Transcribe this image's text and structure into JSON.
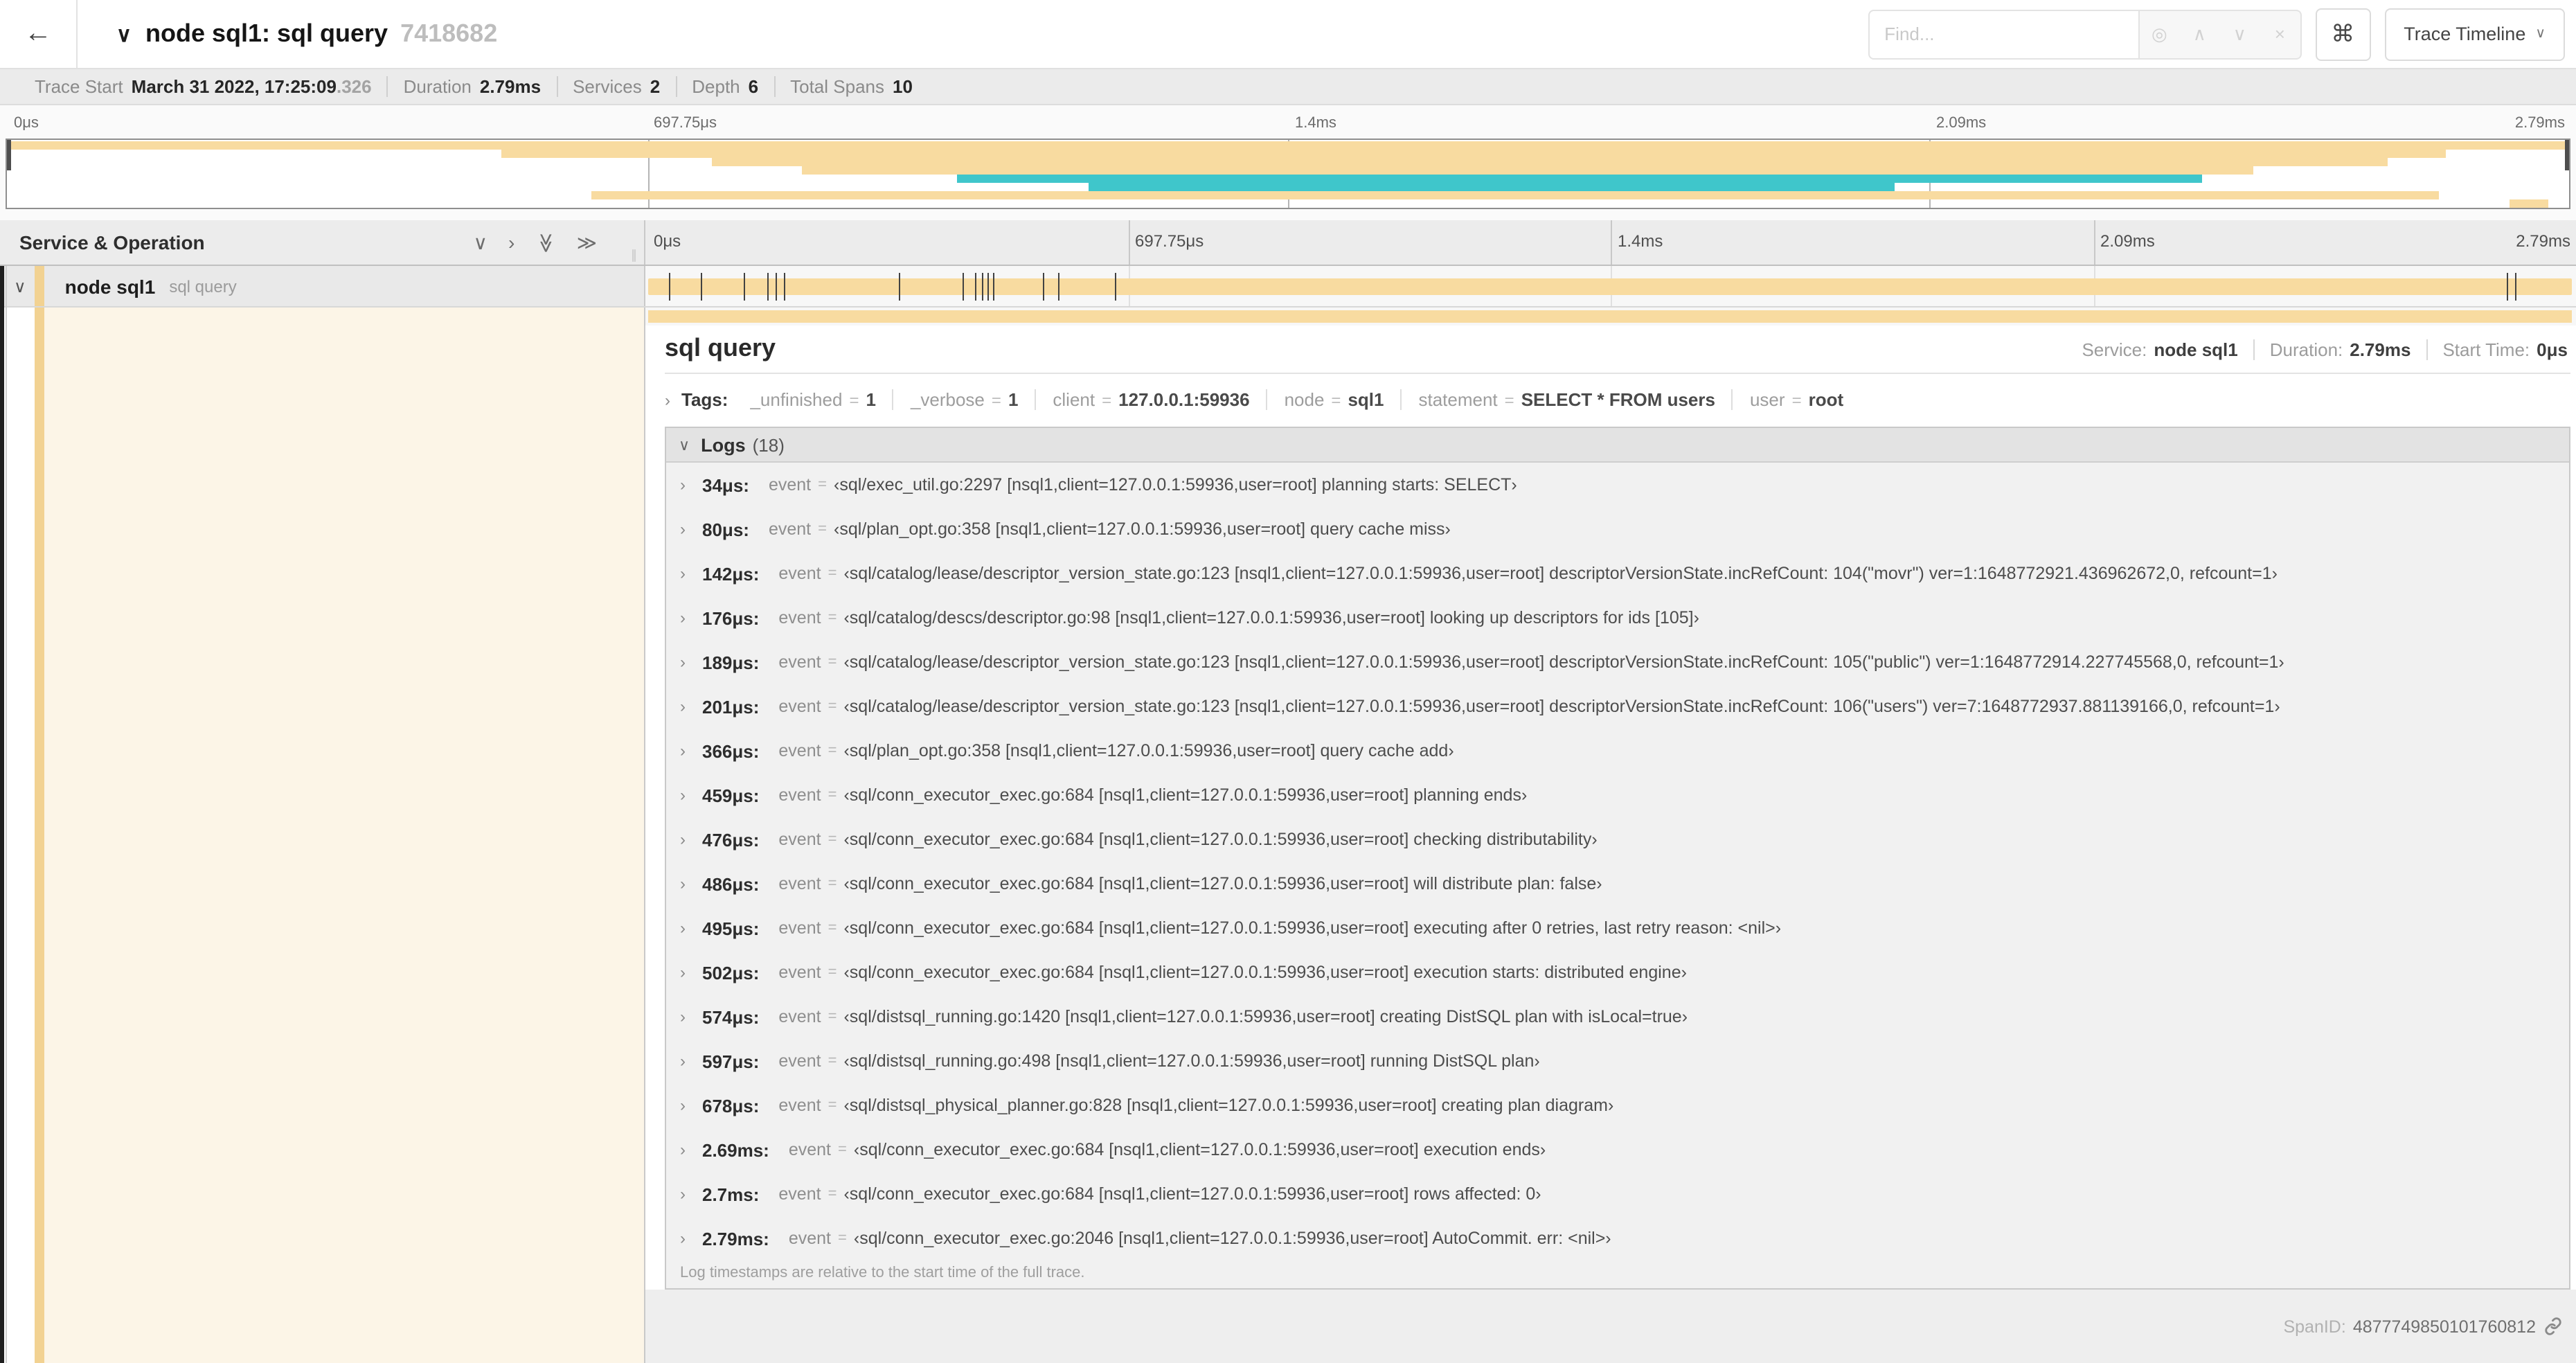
{
  "icons": {
    "back": "←",
    "chevron_down": "∨",
    "chevron_right": "›",
    "double_chevron": "≫",
    "find_target": "◎",
    "find_prev": "∧",
    "find_next": "∨",
    "find_clear": "×",
    "keyboard_cmd": "⌘",
    "resizer_grip": "∥"
  },
  "header": {
    "title": "node sql1: sql query",
    "trace_id_short": "7418682",
    "find_placeholder": "Find...",
    "view_selector_label": "Trace Timeline"
  },
  "trace_info": {
    "items": [
      {
        "label": "Trace Start",
        "value": "March 31 2022, 17:25:09",
        "suffix": ".326"
      },
      {
        "label": "Duration",
        "value": "2.79ms"
      },
      {
        "label": "Services",
        "value": "2"
      },
      {
        "label": "Depth",
        "value": "6"
      },
      {
        "label": "Total Spans",
        "value": "10"
      }
    ]
  },
  "colors": {
    "tan": "#f8dba0",
    "tan_stripe": "#f2d292",
    "cream": "#fcf5e7",
    "teal": "#3fc6cb"
  },
  "minimap": {
    "axis_labels": [
      "0μs",
      "697.75μs",
      "1.4ms",
      "2.09ms",
      "2.79ms"
    ],
    "rows": [
      {
        "start": 0,
        "end": 100,
        "color": "tan"
      },
      {
        "start": 19.3,
        "end": 95.2,
        "color": "tan"
      },
      {
        "start": 27.5,
        "end": 92.9,
        "color": "tan"
      },
      {
        "start": 31.0,
        "end": 87.7,
        "color": "tan"
      },
      {
        "start": 37.1,
        "end": 85.7,
        "color": "teal"
      },
      {
        "start": 42.2,
        "end": 73.7,
        "color": "teal"
      },
      {
        "start": 22.8,
        "end": 94.9,
        "color": "tan"
      },
      {
        "start": 97.7,
        "end": 99.2,
        "color": "tan"
      }
    ]
  },
  "timeline": {
    "columns_header": "Service & Operation",
    "axis_labels": [
      "0μs",
      "697.75μs",
      "1.4ms",
      "2.09ms",
      "2.79ms"
    ],
    "total_us": 2790,
    "span_row": {
      "service": "node sql1",
      "operation": "sql query"
    },
    "tick_times_us": [
      34,
      80,
      142,
      176,
      189,
      201,
      366,
      459,
      476,
      486,
      495,
      502,
      574,
      597,
      678,
      2690,
      2701
    ]
  },
  "detail": {
    "title": "sql query",
    "meta": [
      {
        "label": "Service:",
        "value": "node sql1"
      },
      {
        "label": "Duration:",
        "value": "2.79ms"
      },
      {
        "label": "Start Time:",
        "value": "0μs"
      }
    ],
    "tags": {
      "label": "Tags:",
      "eq": "=",
      "items": [
        {
          "key": "_unfinished",
          "value": "1"
        },
        {
          "key": "_verbose",
          "value": "1"
        },
        {
          "key": "client",
          "value": "127.0.0.1:59936"
        },
        {
          "key": "node",
          "value": "sql1"
        },
        {
          "key": "statement",
          "value": "SELECT * FROM users"
        },
        {
          "key": "user",
          "value": "root"
        }
      ]
    },
    "logs": {
      "label": "Logs",
      "count": "(18)",
      "eq": "=",
      "entries": [
        {
          "t": "34μs:",
          "field": "event",
          "v": "‹sql/exec_util.go:2297 [nsql1,client=127.0.0.1:59936,user=root] planning starts: SELECT›"
        },
        {
          "t": "80μs:",
          "field": "event",
          "v": "‹sql/plan_opt.go:358 [nsql1,client=127.0.0.1:59936,user=root] query cache miss›"
        },
        {
          "t": "142μs:",
          "field": "event",
          "v": "‹sql/catalog/lease/descriptor_version_state.go:123 [nsql1,client=127.0.0.1:59936,user=root] descriptorVersionState.incRefCount: 104(\"movr\") ver=1:1648772921.436962672,0, refcount=1›"
        },
        {
          "t": "176μs:",
          "field": "event",
          "v": "‹sql/catalog/descs/descriptor.go:98 [nsql1,client=127.0.0.1:59936,user=root] looking up descriptors for ids [105]›"
        },
        {
          "t": "189μs:",
          "field": "event",
          "v": "‹sql/catalog/lease/descriptor_version_state.go:123 [nsql1,client=127.0.0.1:59936,user=root] descriptorVersionState.incRefCount: 105(\"public\") ver=1:1648772914.227745568,0, refcount=1›"
        },
        {
          "t": "201μs:",
          "field": "event",
          "v": "‹sql/catalog/lease/descriptor_version_state.go:123 [nsql1,client=127.0.0.1:59936,user=root] descriptorVersionState.incRefCount: 106(\"users\") ver=7:1648772937.881139166,0, refcount=1›"
        },
        {
          "t": "366μs:",
          "field": "event",
          "v": "‹sql/plan_opt.go:358 [nsql1,client=127.0.0.1:59936,user=root] query cache add›"
        },
        {
          "t": "459μs:",
          "field": "event",
          "v": "‹sql/conn_executor_exec.go:684 [nsql1,client=127.0.0.1:59936,user=root] planning ends›"
        },
        {
          "t": "476μs:",
          "field": "event",
          "v": "‹sql/conn_executor_exec.go:684 [nsql1,client=127.0.0.1:59936,user=root] checking distributability›"
        },
        {
          "t": "486μs:",
          "field": "event",
          "v": "‹sql/conn_executor_exec.go:684 [nsql1,client=127.0.0.1:59936,user=root] will distribute plan: false›"
        },
        {
          "t": "495μs:",
          "field": "event",
          "v": "‹sql/conn_executor_exec.go:684 [nsql1,client=127.0.0.1:59936,user=root] executing after 0 retries, last retry reason: <nil>›"
        },
        {
          "t": "502μs:",
          "field": "event",
          "v": "‹sql/conn_executor_exec.go:684 [nsql1,client=127.0.0.1:59936,user=root] execution starts: distributed engine›"
        },
        {
          "t": "574μs:",
          "field": "event",
          "v": "‹sql/distsql_running.go:1420 [nsql1,client=127.0.0.1:59936,user=root] creating DistSQL plan with isLocal=true›"
        },
        {
          "t": "597μs:",
          "field": "event",
          "v": "‹sql/distsql_running.go:498 [nsql1,client=127.0.0.1:59936,user=root] running DistSQL plan›"
        },
        {
          "t": "678μs:",
          "field": "event",
          "v": "‹sql/distsql_physical_planner.go:828 [nsql1,client=127.0.0.1:59936,user=root] creating plan diagram›"
        },
        {
          "t": "2.69ms:",
          "field": "event",
          "v": "‹sql/conn_executor_exec.go:684 [nsql1,client=127.0.0.1:59936,user=root] execution ends›"
        },
        {
          "t": "2.7ms:",
          "field": "event",
          "v": "‹sql/conn_executor_exec.go:684 [nsql1,client=127.0.0.1:59936,user=root] rows affected: 0›"
        },
        {
          "t": "2.79ms:",
          "field": "event",
          "v": "‹sql/conn_executor_exec.go:2046 [nsql1,client=127.0.0.1:59936,user=root] AutoCommit. err: <nil>›"
        }
      ],
      "footnote": "Log timestamps are relative to the start time of the full trace."
    },
    "span_id_label": "SpanID:",
    "span_id": "4877749850101760812"
  }
}
